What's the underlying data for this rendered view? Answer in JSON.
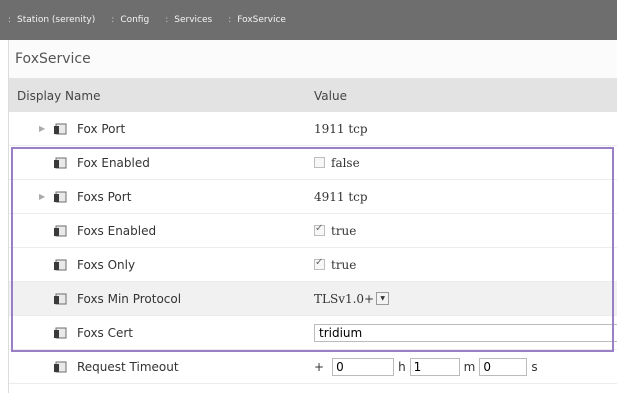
{
  "breadcrumb": [
    {
      "label": "Station (serenity)"
    },
    {
      "label": "Config"
    },
    {
      "label": "Services"
    },
    {
      "label": "FoxService"
    }
  ],
  "panel": {
    "title": "FoxService"
  },
  "table": {
    "col_name": "Display Name",
    "col_value": "Value",
    "rows": {
      "fox_port": {
        "name": "Fox Port",
        "value": "1911 tcp"
      },
      "fox_enabled": {
        "name": "Fox Enabled",
        "value": "false",
        "checked": false
      },
      "foxs_port": {
        "name": "Foxs Port",
        "value": "4911 tcp"
      },
      "foxs_enabled": {
        "name": "Foxs Enabled",
        "value": "true",
        "checked": true
      },
      "foxs_only": {
        "name": "Foxs Only",
        "value": "true",
        "checked": true
      },
      "foxs_min_protocol": {
        "name": "Foxs Min Protocol",
        "value": "TLSv1.0+"
      },
      "foxs_cert": {
        "name": "Foxs Cert",
        "value": "tridium"
      },
      "request_timeout": {
        "name": "Request Timeout",
        "sign": "+",
        "hours": "0",
        "hours_unit": "h",
        "minutes": "1",
        "minutes_unit": "m",
        "seconds": "0",
        "seconds_unit": "s"
      }
    }
  },
  "colors": {
    "breadcrumb_bg": "#6e6e6e",
    "highlight_border": "#9a7fc4",
    "header_bg": "#e3e3e3"
  },
  "icons": {
    "row_icon": "slot-file-icon",
    "expand_icon": "expand-triangle-icon"
  }
}
